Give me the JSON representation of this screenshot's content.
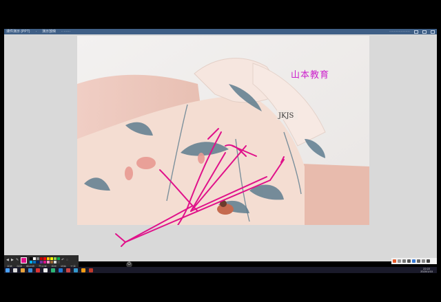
{
  "window": {
    "title_segments": [
      "课件演示 (PPT)",
      "·",
      "演示放映",
      "· ⋯⋯"
    ],
    "right_info": "⋯⋯⋯⋯⋯⋯"
  },
  "slide": {
    "watermark": "山本教育",
    "label_text": "JKJS"
  },
  "pen_toolbar": {
    "current_color": "#e0118a",
    "swatches": [
      "#000000",
      "#ffffff",
      "#7f7f7f",
      "#c00000",
      "#ff0000",
      "#ffc000",
      "#ffff00",
      "#92d050",
      "#00b050",
      "#00b0f0",
      "#0070c0",
      "#002060",
      "#7030a0",
      "#e0118a",
      "#ff99cc",
      "#996633",
      "#d9d9d9",
      "#404040"
    ],
    "labels": [
      "画笔",
      "选择",
      "橡皮擦",
      "荧光笔",
      "清除",
      "放映",
      "工具"
    ]
  },
  "taskbar": {
    "clock_time": "22:22",
    "clock_date": "2020/1/10"
  },
  "colors": {
    "ink": "#e0118a",
    "titlebar": "#3f5f86",
    "workspace": "#d9d9d9"
  }
}
